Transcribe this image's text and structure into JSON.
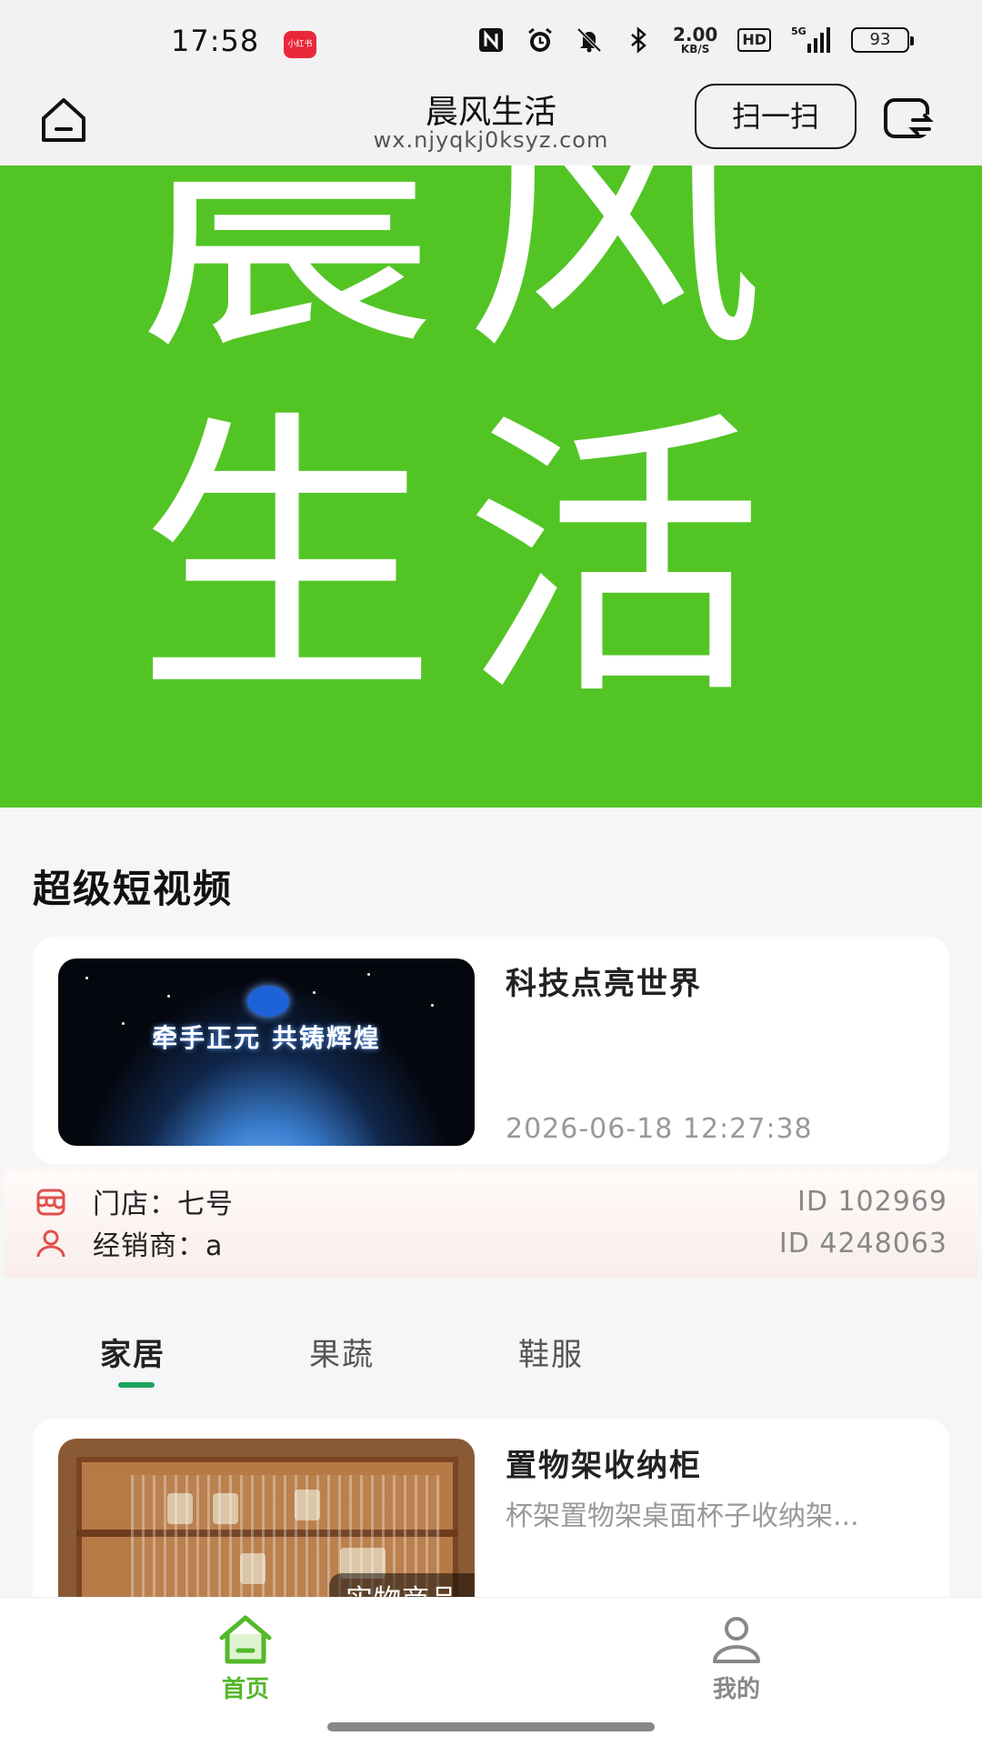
{
  "status_bar": {
    "time": "17:58",
    "app_badge": "小红书",
    "net_speed_value": "2.00",
    "net_speed_unit": "KB/S",
    "hd": "HD",
    "signal": "5G",
    "battery": "93",
    "icons": [
      "nfc-icon",
      "alarm-icon",
      "mute-icon",
      "bluetooth-icon",
      "signal-icon",
      "battery-icon"
    ]
  },
  "nav": {
    "title": "晨风生活",
    "url": "wx.njyqkj0ksyz.com",
    "scan_label": "扫一扫"
  },
  "banner": {
    "line1": "晨风",
    "line2": "生活",
    "bg_color": "#52c525"
  },
  "video_section": {
    "title": "超级短视频",
    "item": {
      "thumb_caption": "牵手正元 共铸辉煌",
      "title": "科技点亮世界",
      "time": "2026-06-18 12:27:38"
    }
  },
  "store": {
    "store_label": "门店：七号",
    "store_id": "ID 102969",
    "dealer_label": "经销商：a",
    "dealer_id": "ID 4248063"
  },
  "category_tabs": [
    {
      "label": "家居",
      "active": true
    },
    {
      "label": "果蔬",
      "active": false
    },
    {
      "label": "鞋服",
      "active": false
    }
  ],
  "product": {
    "badge": "实物商品",
    "title": "置物架收纳柜",
    "desc": "杯架置物架桌面杯子收纳架..."
  },
  "tabbar": {
    "home_label": "首页",
    "mine_label": "我的",
    "accent": "#53b82a"
  }
}
